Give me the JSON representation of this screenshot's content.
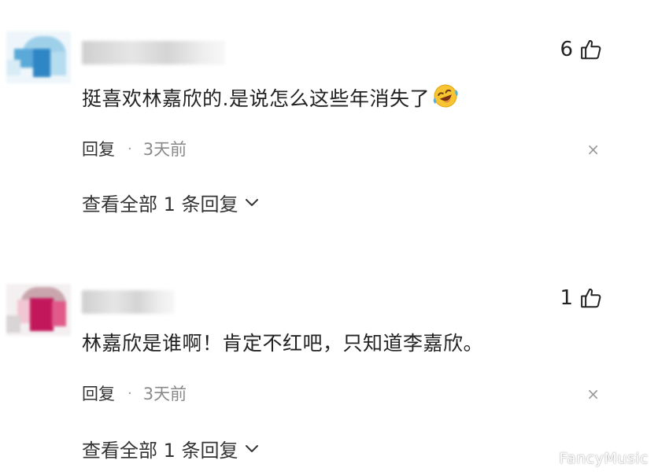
{
  "comments": [
    {
      "username_visible": "",
      "text": "挺喜欢林嘉欣的.是说怎么这些年消失了",
      "emoji_icon": "laughing-tears-emoji",
      "likes": "6",
      "reply_label": "回复",
      "separator": "·",
      "time": "3天前",
      "close_label": "×",
      "view_replies_label": "查看全部 1 条回复",
      "avatar_colors": [
        "#5aa9d8",
        "#2f86c4",
        "#9fd0ea",
        "#d8ecf6"
      ]
    },
    {
      "username_visible": "",
      "text": "林嘉欣是谁啊！肯定不红吧，只知道李嘉欣。",
      "emoji_icon": "",
      "likes": "1",
      "reply_label": "回复",
      "separator": "·",
      "time": "3天前",
      "close_label": "×",
      "view_replies_label": "查看全部 1 条回复",
      "avatar_colors": [
        "#c2185b",
        "#e05a8a",
        "#9e9e9e",
        "#f2c6d3"
      ]
    }
  ],
  "watermark": "FancyMusic",
  "icons": {
    "like": "thumbs-up-icon",
    "close": "close-icon",
    "chevron": "chevron-down-icon"
  }
}
